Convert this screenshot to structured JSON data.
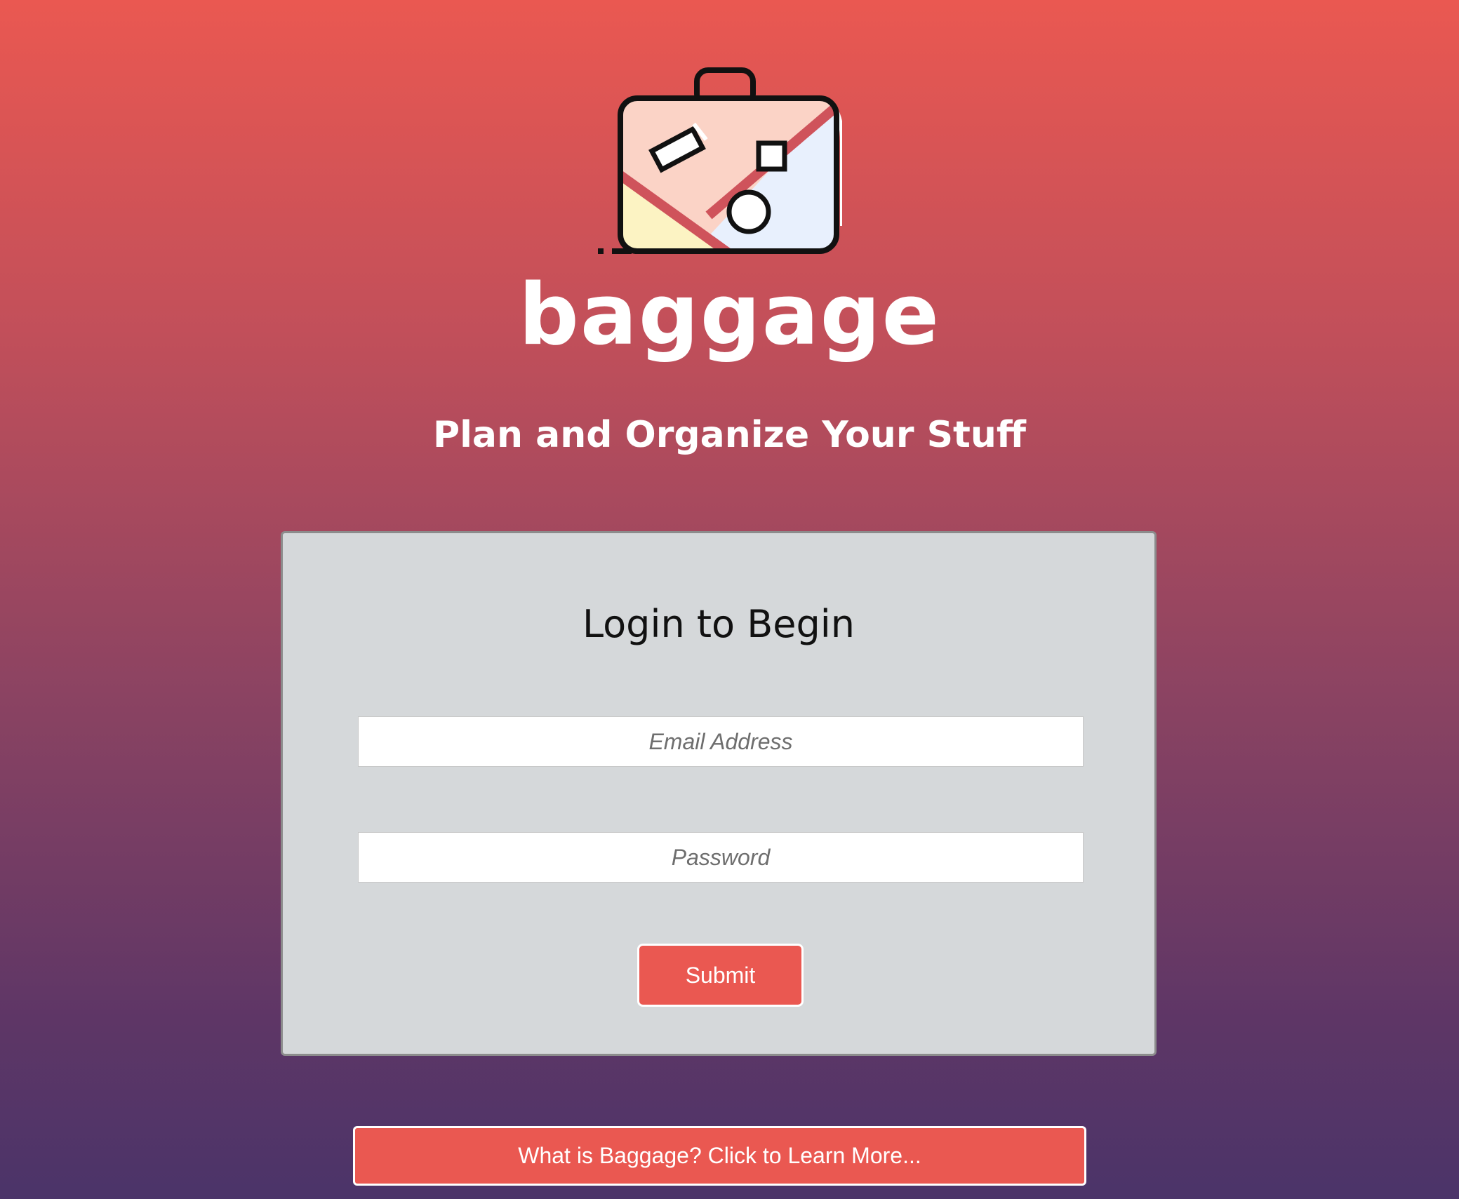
{
  "header": {
    "logo_icon": "suitcase-icon",
    "brand_name": "baggage",
    "tagline": "Plan and Organize Your Stuff"
  },
  "login": {
    "title": "Login to Begin",
    "email_placeholder": "Email Address",
    "email_value": "",
    "password_placeholder": "Password",
    "password_value": "",
    "submit_label": "Submit"
  },
  "footer": {
    "learn_more_label": "What is Baggage? Click to Learn More..."
  },
  "colors": {
    "accent": "#ea5851",
    "gradient_top": "#ea5851",
    "gradient_bottom": "#4b3469",
    "card_background": "#d5d8da"
  }
}
